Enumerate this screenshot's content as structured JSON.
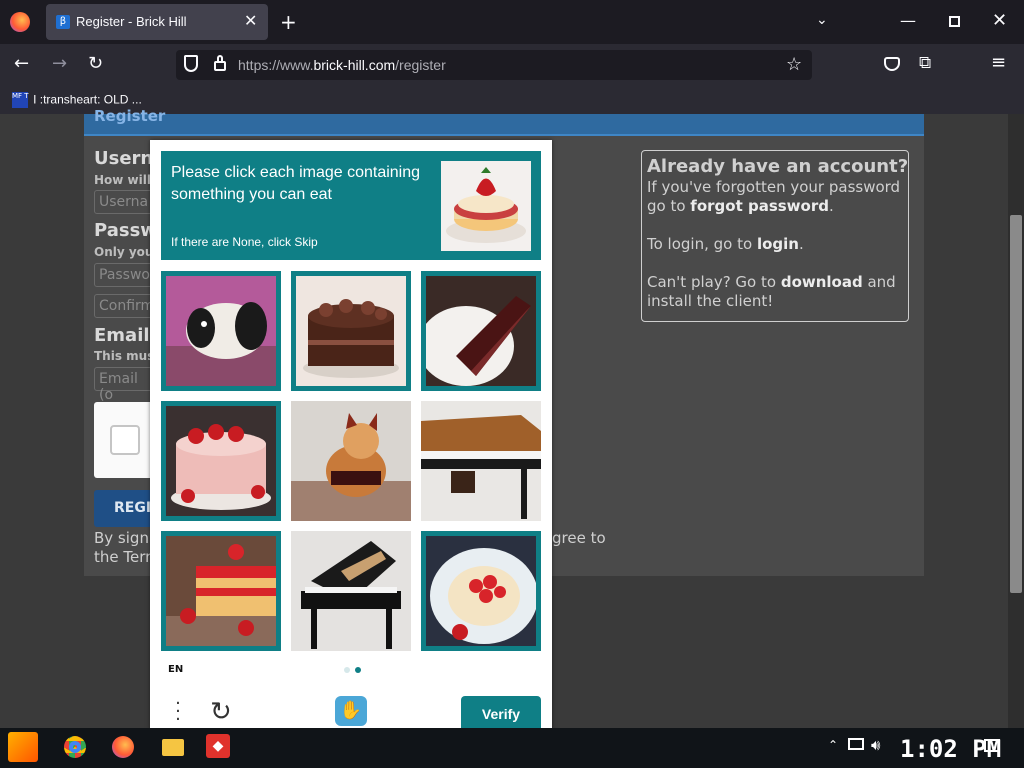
{
  "browser": {
    "tab_title": "Register - Brick Hill",
    "url_prefix": "https://www.",
    "url_domain": "brick-hill.com",
    "url_path": "/register",
    "bookmark": "I :transheart: OLD ..."
  },
  "page": {
    "header": "Register",
    "username_label": "Usern",
    "username_hint": "How will",
    "username_placeholder": "Userna",
    "password_label": "Passw",
    "password_hint": "Only you",
    "password_placeholder": "Passwo",
    "confirm_placeholder": "Confirm",
    "email_label": "Email",
    "email_hint": "This mus",
    "email_placeholder": "Email (o",
    "register_button": "REGIS",
    "terms_line1": "By signi",
    "terms_line1_end": "gree to",
    "terms_line2": "the Tern",
    "account": {
      "title": "Already have an account?",
      "forgot_pre": "If you've forgotten your password go to ",
      "forgot_link": "forgot password",
      "forgot_post": ".",
      "login_pre": "To login, go to ",
      "login_link": "login",
      "login_post": ".",
      "play_pre": "Can't play? Go to ",
      "play_link": "download",
      "play_post": " and install the client!"
    }
  },
  "captcha": {
    "prompt": "Please click each image containing something you can eat",
    "skip_hint": "If there are None, click Skip",
    "language": "EN",
    "verify_label": "Verify",
    "page_index": 2,
    "page_count": 2,
    "tiles": [
      {
        "name": "panda",
        "selected": true
      },
      {
        "name": "chocolate-cake",
        "selected": true
      },
      {
        "name": "chocolate-cake-slice",
        "selected": true
      },
      {
        "name": "strawberry-cake",
        "selected": true
      },
      {
        "name": "cat",
        "selected": false
      },
      {
        "name": "piano",
        "selected": false
      },
      {
        "name": "strawberry-layer-cake",
        "selected": true
      },
      {
        "name": "grand-piano",
        "selected": false
      },
      {
        "name": "strawberry-cheesecake",
        "selected": true
      }
    ]
  },
  "taskbar": {
    "clock": "1:02 PM"
  }
}
